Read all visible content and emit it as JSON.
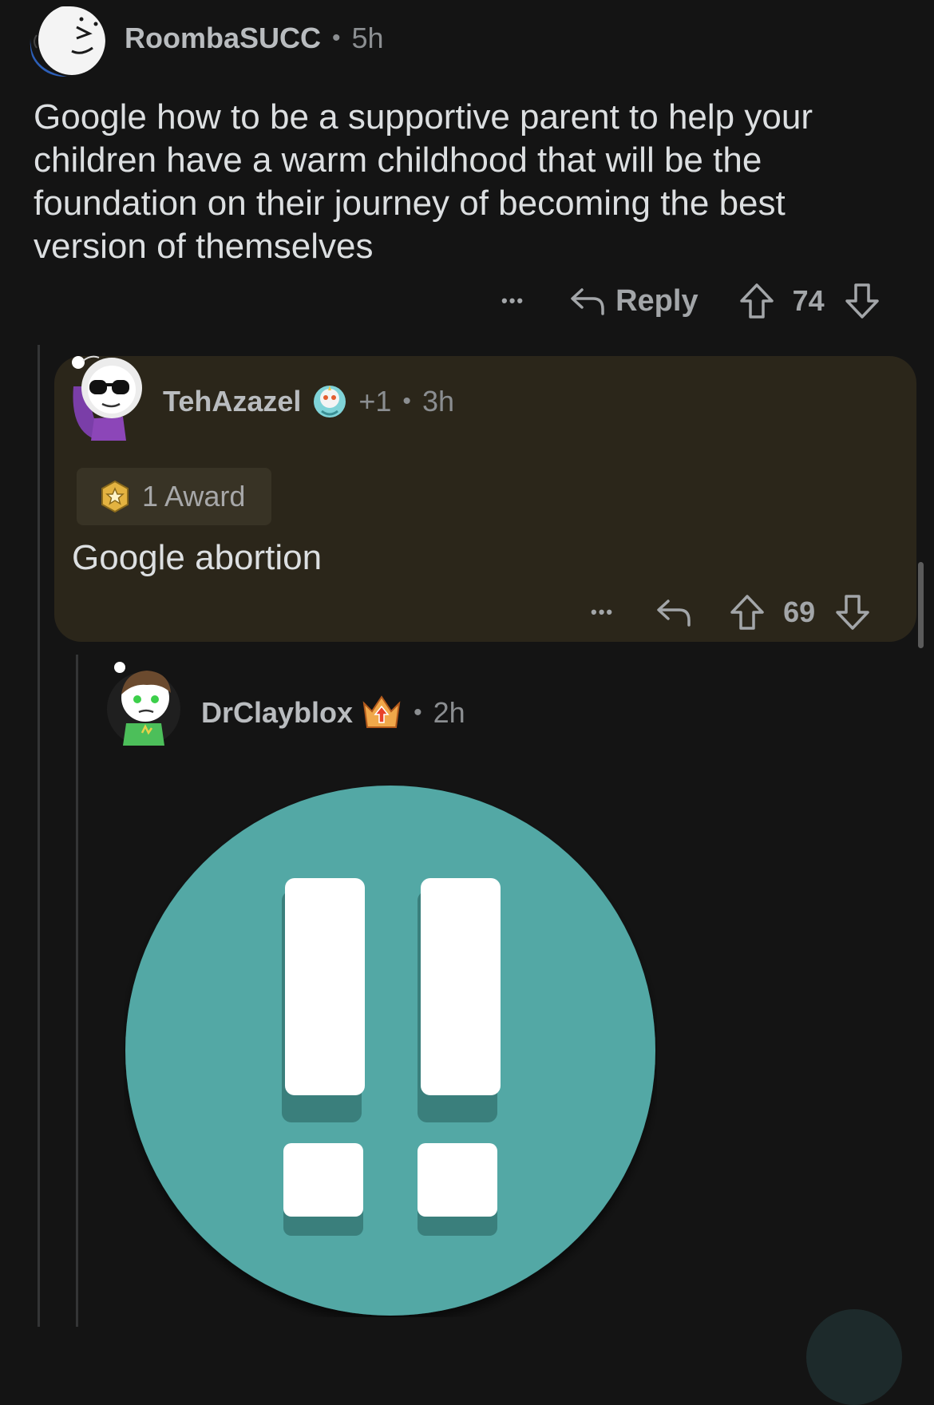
{
  "comment1": {
    "username": "RoombaSUCC",
    "separator": "•",
    "age": "5h",
    "body": "Google how to be a supportive parent to help your children have a warm childhood that will be the foundation on their journey of becoming the best version of themselves",
    "more_label": "•••",
    "reply_label": "Reply",
    "score": "74"
  },
  "comment2": {
    "username": "TehAzazel",
    "flair": "+1",
    "separator": "•",
    "age": "3h",
    "award_label": "1 Award",
    "body": "Google abortion",
    "more_label": "•••",
    "score": "69"
  },
  "comment3": {
    "username": "DrClayblox",
    "separator": "•",
    "age": "2h",
    "image_icon": "double-exclamation-icon",
    "image_color": "#52a8a5"
  },
  "colors": {
    "background": "#141414",
    "highlight": "#2b261a",
    "thread_line": "#343536"
  }
}
